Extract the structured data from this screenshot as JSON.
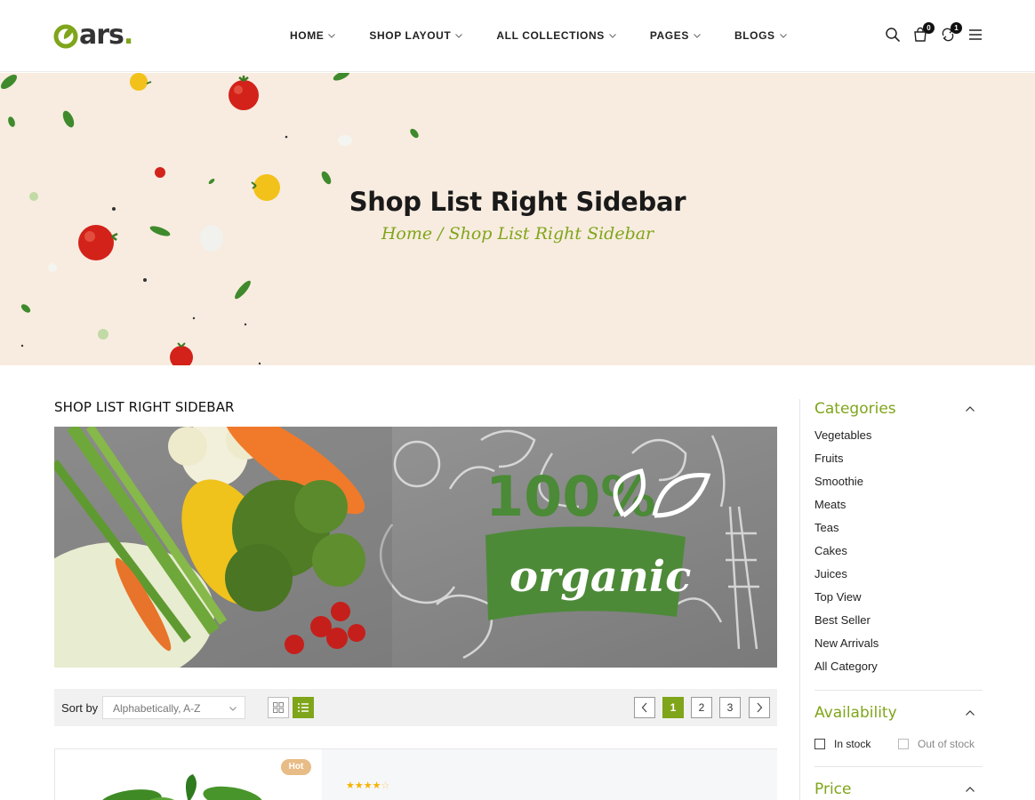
{
  "header": {
    "logo_text": "ars",
    "logo_dot": ".",
    "nav": [
      {
        "label": "HOME",
        "dropdown": true
      },
      {
        "label": "SHOP LAYOUT",
        "dropdown": true
      },
      {
        "label": "ALL COLLECTIONS",
        "dropdown": true
      },
      {
        "label": "PAGES",
        "dropdown": true
      },
      {
        "label": "BLOGS",
        "dropdown": true
      }
    ],
    "icons": [
      "search-icon",
      "cart-icon",
      "compare-icon",
      "menu-icon"
    ],
    "cart_count": "0",
    "compare_count": "1"
  },
  "hero": {
    "title": "Shop List Right Sidebar",
    "breadcrumb": "Home / Shop List Right Sidebar"
  },
  "main": {
    "heading": "SHOP LIST RIGHT SIDEBAR",
    "banner": {
      "big_text": "100%",
      "ribbon_text": "organic"
    },
    "toolbar": {
      "sort_label": "Sort by",
      "sort_value": "Alphabetically, A-Z",
      "views": [
        "grid-view-icon",
        "list-view-icon"
      ],
      "active_view": "list",
      "pages": [
        "1",
        "2",
        "3"
      ],
      "current_page": "1"
    },
    "product": {
      "badge": "Hot",
      "rating": 4,
      "rating_max": 5
    }
  },
  "sidebar": {
    "categories_title": "Categories",
    "categories": [
      "Vegetables",
      "Fruits",
      "Smoothie",
      "Meats",
      "Teas",
      "Cakes",
      "Juices",
      "Top View",
      "Best Seller",
      "New Arrivals",
      "All Category"
    ],
    "availability_title": "Availability",
    "availability": [
      {
        "label": "In stock",
        "checked": false
      },
      {
        "label": "Out of stock",
        "checked": false
      }
    ],
    "price_title": "Price"
  },
  "colors": {
    "accent": "#7fa51a",
    "hero_bg": "#f8ece0",
    "hot_badge": "#e8bc86",
    "star": "#f5b301"
  }
}
